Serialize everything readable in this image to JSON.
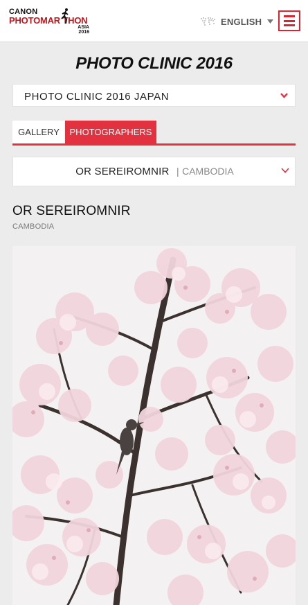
{
  "header": {
    "logo": {
      "line1": "CANON",
      "line2": "PHOTOMAR  THON",
      "line3": "ASIA",
      "line4": "2016"
    },
    "language": {
      "label": "ENGLISH"
    }
  },
  "page": {
    "title": "PHOTO CLINIC 2016"
  },
  "event_select": {
    "value": "PHOTO CLINIC 2016 JAPAN"
  },
  "tabs": [
    {
      "label": "GALLERY",
      "active": false
    },
    {
      "label": "PHOTOGRAPHERS",
      "active": true
    }
  ],
  "photographer_select": {
    "name": "OR SEREIROMNIR",
    "separator": "|",
    "country": "CAMBODIA"
  },
  "photographer": {
    "name": "OR SEREIROMNIR",
    "country": "CAMBODIA"
  },
  "colors": {
    "accent": "#e2313f",
    "header_bg": "#ffffff",
    "page_bg": "#ececec"
  },
  "icons": {
    "globe": "world-map-icon",
    "caret": "caret-down-icon",
    "menu": "hamburger-menu-icon",
    "chevron": "chevron-down-icon"
  }
}
